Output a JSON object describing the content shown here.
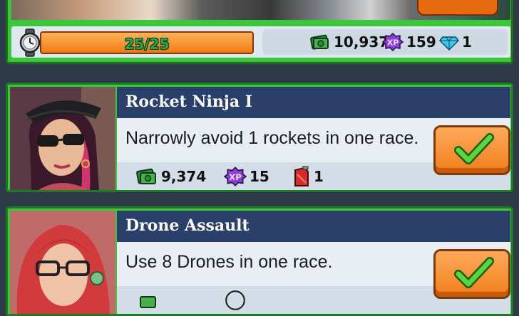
{
  "status": {
    "energy": {
      "text": "25/25",
      "fraction": 1.0
    },
    "cash": "10,937",
    "xp": "159",
    "gems": "1",
    "xp_badge": "XP"
  },
  "quests": [
    {
      "title": "Rocket Ninja I",
      "description": "Narrowly avoid 1 rockets in one race.",
      "reward_cash": "9,374",
      "reward_xp": "15",
      "reward_fuel": "1",
      "xp_badge": "XP"
    },
    {
      "title": "Drone Assault",
      "description": "Use 8 Drones in one race."
    }
  ],
  "colors": {
    "card_border": "#3cc73a",
    "title_bar": "#2b3f6b",
    "energy_bar": "#f07b12",
    "claim_button": "#f07e1c"
  }
}
